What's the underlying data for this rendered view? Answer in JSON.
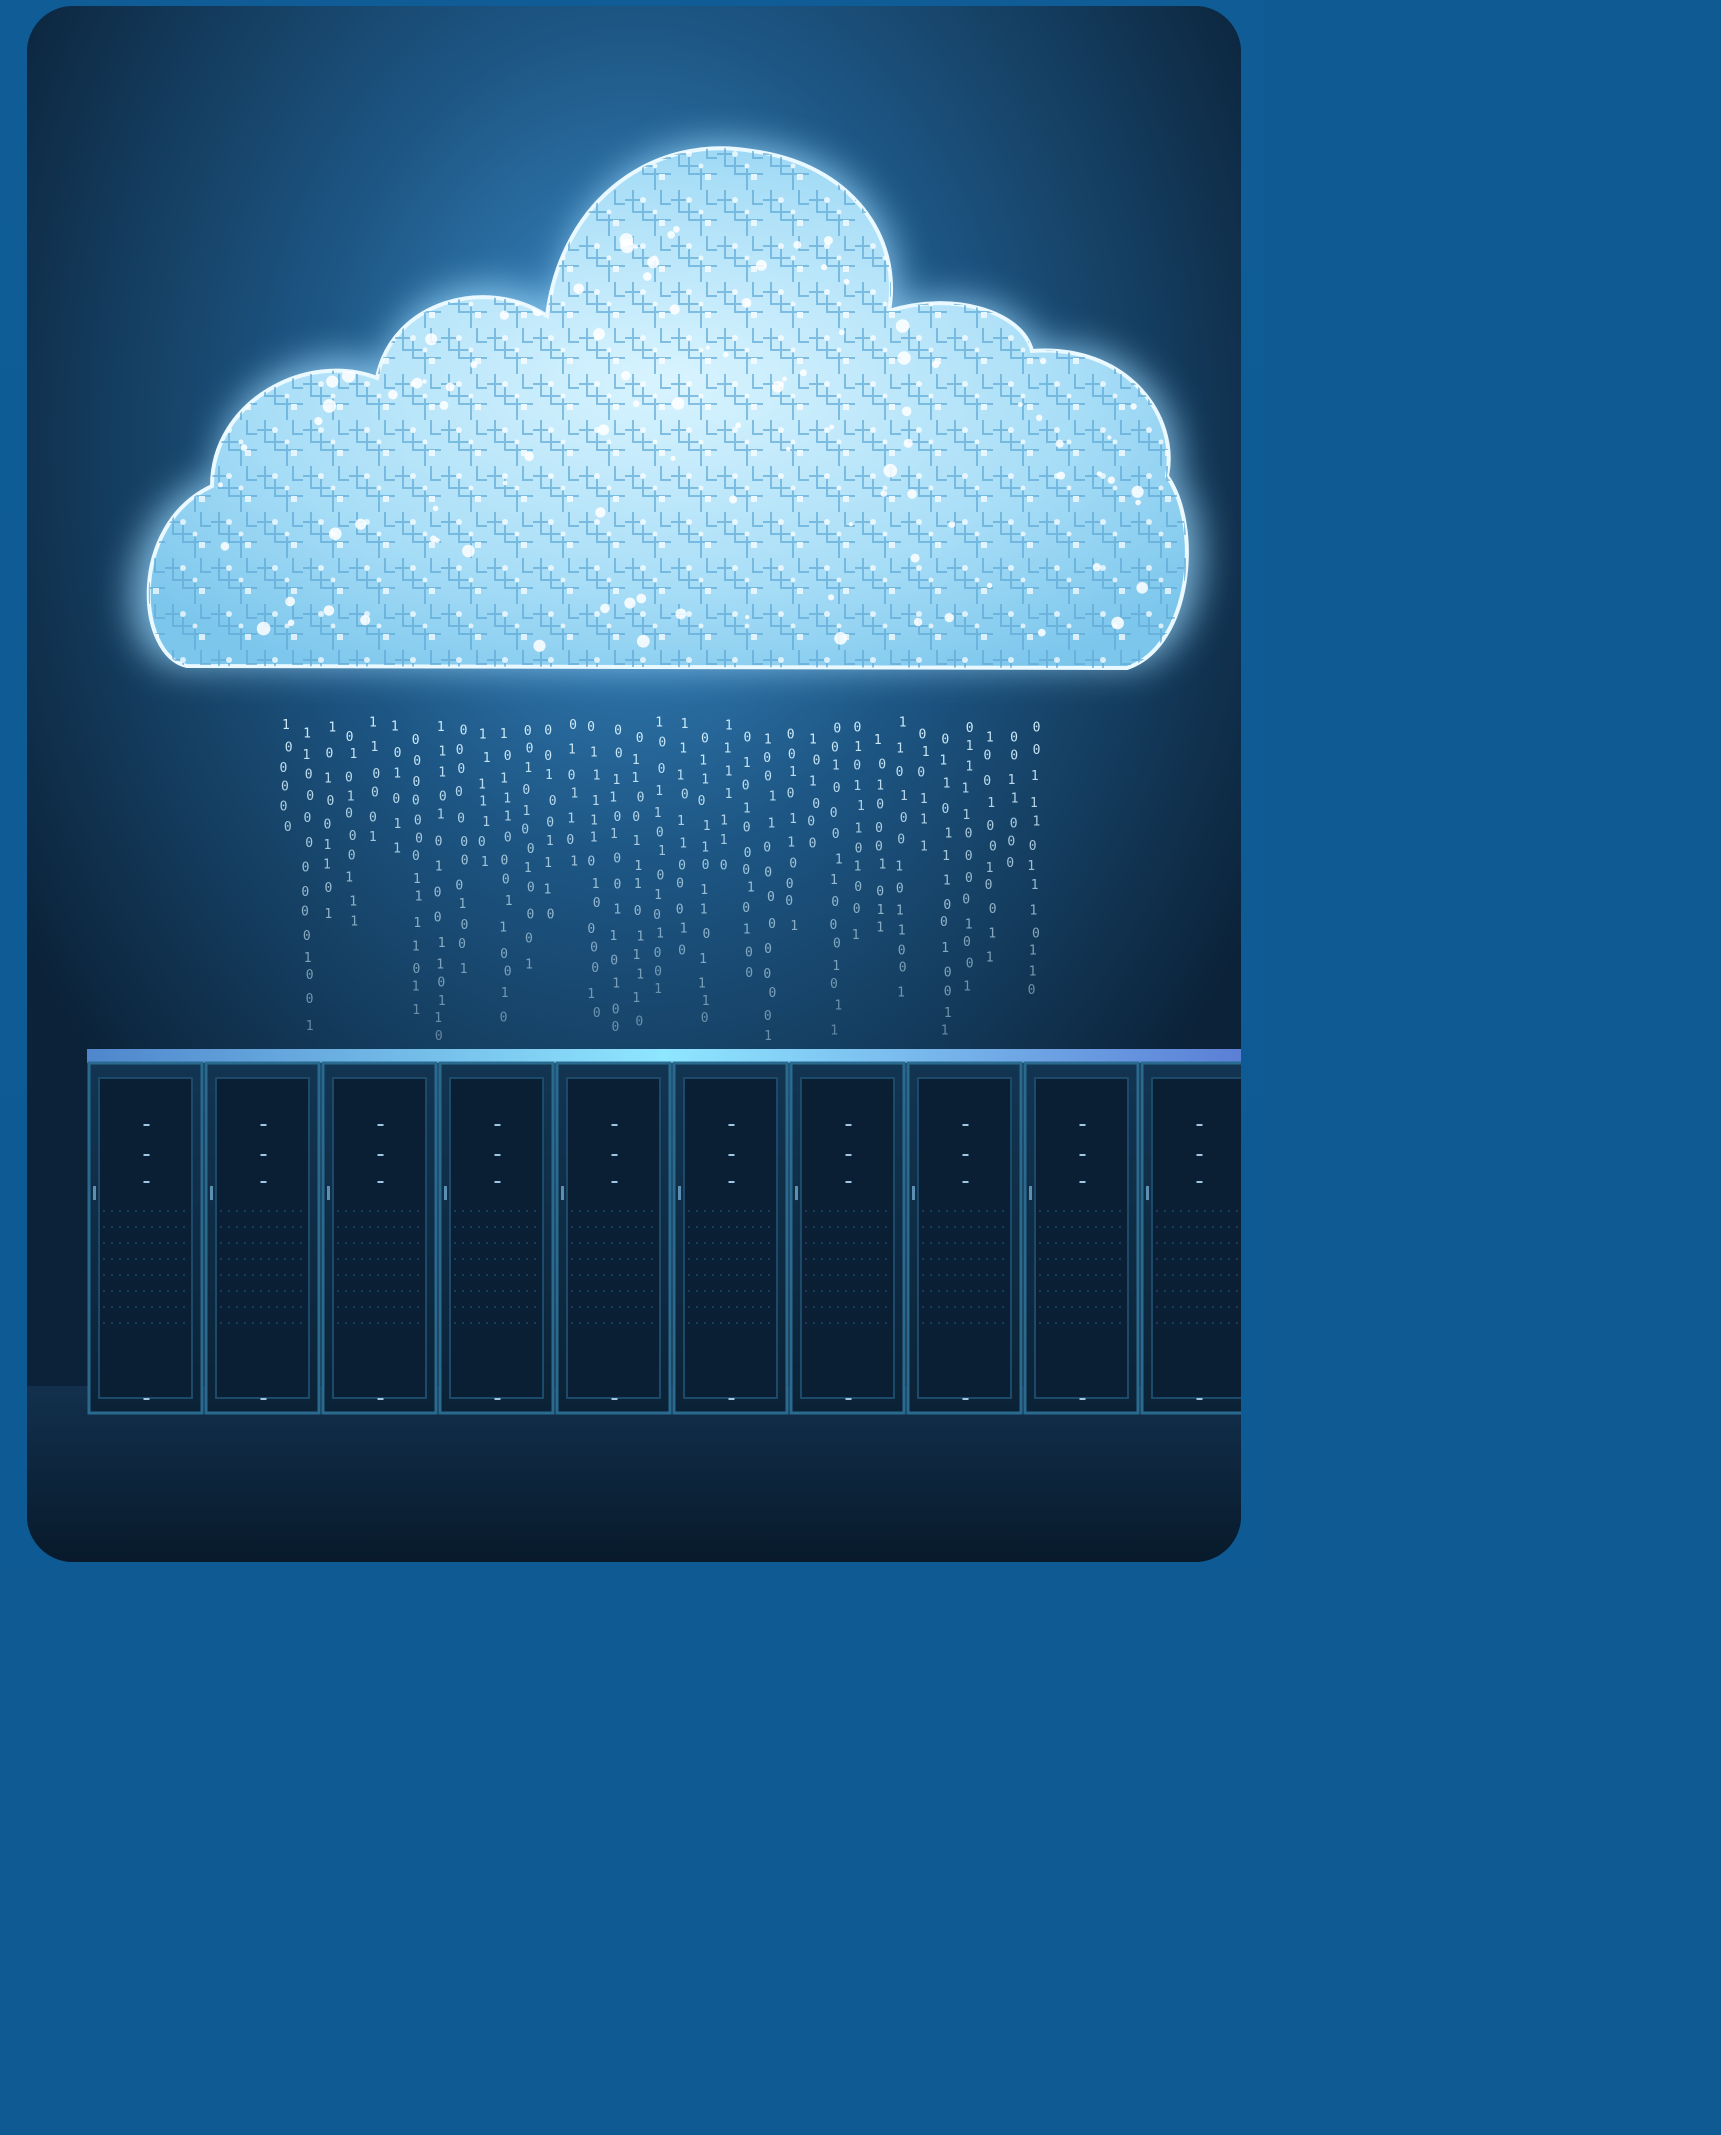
{
  "image": {
    "subject": "cloud-circuit-over-server-racks",
    "colors": {
      "frame": "#0f5a93",
      "glow": "#bfe8ff",
      "binary": "#d6f2ff",
      "rack": "#0d2840",
      "rack_top": "#5a9ee0",
      "floor": "#0a2137"
    },
    "binary_digits": [
      "0",
      "1"
    ],
    "rack_count": 10
  }
}
